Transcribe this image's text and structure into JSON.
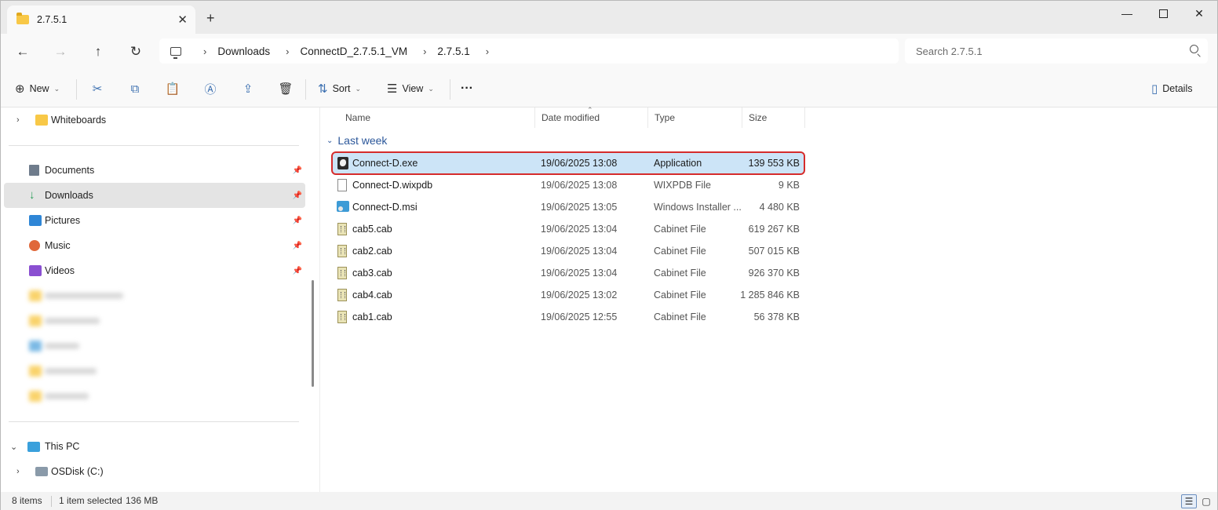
{
  "window": {
    "tab_title": "2.7.5.1",
    "tab_close": "✕",
    "new_tab": "+",
    "controls": {
      "minimize": "—",
      "close": "✕"
    }
  },
  "nav": {
    "back": "←",
    "forward": "→",
    "up": "↑",
    "refresh": "↻",
    "breadcrumbs": [
      "Downloads",
      "ConnectD_2.7.5.1_VM",
      "2.7.5.1"
    ],
    "separator": "›",
    "search_placeholder": "Search 2.7.5.1"
  },
  "commands": {
    "new_label": "New",
    "sort_label": "Sort",
    "view_label": "View",
    "more": "···",
    "details_label": "Details",
    "icons": {
      "new": "⊕",
      "cut": "✂",
      "copy": "⧉",
      "paste": "📋",
      "rename": "Ⓐ",
      "share": "⇪",
      "delete": "🗑",
      "sort": "⇅",
      "view": "☰",
      "details": "▯"
    },
    "chevron": "⌄"
  },
  "sidebar": {
    "items": [
      {
        "label": "Whiteboards",
        "icon": "folder-icon",
        "expand": "›"
      },
      {
        "label": "Documents",
        "icon": "documents-icon",
        "pin": "📌"
      },
      {
        "label": "Downloads",
        "icon": "download-icon",
        "pin": "📌",
        "selected": true
      },
      {
        "label": "Pictures",
        "icon": "pictures-icon",
        "pin": "📌"
      },
      {
        "label": "Music",
        "icon": "music-icon",
        "pin": "📌"
      },
      {
        "label": "Videos",
        "icon": "videos-icon",
        "pin": "📌"
      },
      {
        "label": "This PC",
        "icon": "this-pc-icon",
        "expand": "⌄"
      },
      {
        "label": "OSDisk (C:)",
        "icon": "disk-icon",
        "expand": "›"
      }
    ]
  },
  "columns": {
    "name": "Name",
    "date": "Date modified",
    "type": "Type",
    "size": "Size",
    "sort_indicator": "⌃"
  },
  "group": {
    "label": "Last week",
    "chevron": "⌄"
  },
  "files": [
    {
      "name": "Connect-D.exe",
      "date": "19/06/2025 13:08",
      "type": "Application",
      "size": "139 553 KB",
      "icon": "exe-icon",
      "selected": true
    },
    {
      "name": "Connect-D.wixpdb",
      "date": "19/06/2025 13:08",
      "type": "WIXPDB File",
      "size": "9 KB",
      "icon": "file-icon"
    },
    {
      "name": "Connect-D.msi",
      "date": "19/06/2025 13:05",
      "type": "Windows Installer ...",
      "size": "4 480 KB",
      "icon": "msi-icon"
    },
    {
      "name": "cab5.cab",
      "date": "19/06/2025 13:04",
      "type": "Cabinet File",
      "size": "619 267 KB",
      "icon": "cab-icon"
    },
    {
      "name": "cab2.cab",
      "date": "19/06/2025 13:04",
      "type": "Cabinet File",
      "size": "507 015 KB",
      "icon": "cab-icon"
    },
    {
      "name": "cab3.cab",
      "date": "19/06/2025 13:04",
      "type": "Cabinet File",
      "size": "926 370 KB",
      "icon": "cab-icon"
    },
    {
      "name": "cab4.cab",
      "date": "19/06/2025 13:02",
      "type": "Cabinet File",
      "size": "1 285 846 KB",
      "icon": "cab-icon"
    },
    {
      "name": "cab1.cab",
      "date": "19/06/2025 12:55",
      "type": "Cabinet File",
      "size": "56 378 KB",
      "icon": "cab-icon"
    }
  ],
  "status": {
    "count": "8 items",
    "selection": "1 item selected",
    "selection_size": "136 MB",
    "view_details_icon": "☰",
    "view_tiles_icon": "▢"
  },
  "colors": {
    "accent": "#2b579a",
    "selection": "#cce4f7",
    "highlight_border": "#d52c2c"
  }
}
